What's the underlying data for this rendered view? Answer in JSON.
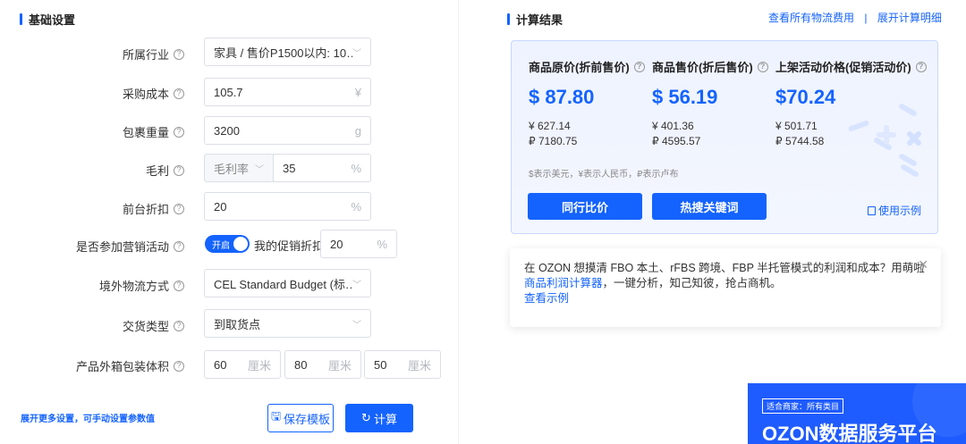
{
  "left": {
    "section_title": "基础设置",
    "rows": {
      "industry": {
        "label": "所属行业",
        "value": "家具 / 售价P1500以内: 10…"
      },
      "cost": {
        "label": "采购成本",
        "value": "105.7",
        "unit": "¥"
      },
      "weight": {
        "label": "包裹重量",
        "value": "3200",
        "unit": "g"
      },
      "margin": {
        "label": "毛利",
        "mode": "毛利率",
        "value": "35",
        "unit": "%"
      },
      "discount": {
        "label": "前台折扣",
        "value": "20",
        "unit": "%"
      },
      "promo": {
        "label": "是否参加营销活动",
        "toggle_text": "开启",
        "toggle_on": true,
        "sub_label": "我的促销折扣",
        "value": "20",
        "unit": "%"
      },
      "logistics": {
        "label": "境外物流方式",
        "value": "CEL Standard Budget (标…"
      },
      "delivery": {
        "label": "交货类型",
        "value": "到取货点"
      },
      "volume": {
        "label": "产品外箱包装体积",
        "length": "60",
        "width": "80",
        "height": "50",
        "unit": "厘米"
      }
    },
    "more_settings_link": "展开更多设置，可手动设置参数值",
    "save_template_label": "保存模板",
    "calculate_label": "计算"
  },
  "right": {
    "section_title": "计算结果",
    "link_all_fees": "查看所有物流费用",
    "link_separator": "|",
    "link_expand_details": "展开计算明细",
    "columns": [
      {
        "header": "商品原价(折前售价)",
        "usd": "$ 87.80",
        "cny": "¥ 627.14",
        "rub": "₽ 7180.75"
      },
      {
        "header": "商品售价(折后售价)",
        "usd": "$ 56.19",
        "cny": "¥ 401.36",
        "rub": "₽ 4595.57"
      },
      {
        "header": "上架活动价格(促销活动价)",
        "usd": "$70.24",
        "cny": "¥ 501.71",
        "rub": "₽ 5744.58"
      }
    ],
    "currency_note": "$表示美元，¥表示人民币，₽表示卢布",
    "btn_compare": "同行比价",
    "btn_keywords": "热搜关键词",
    "usage_link": "使用示例",
    "promo": {
      "text_before": "在 OZON 想摸清 FBO 本土、rFBS 跨境、FBP 半托管模式的利润和成本？用萌啦",
      "link_calc": "商品利润计算器",
      "text_after": "，一键分析，知己知彼，抢占商机。",
      "link_example": "查看示例"
    },
    "banner": {
      "tag": "适合商家：所有类目",
      "title": "OZON数据服务平台"
    }
  },
  "colors": {
    "accent": "#1463ff",
    "banner": "#1f5cff"
  }
}
